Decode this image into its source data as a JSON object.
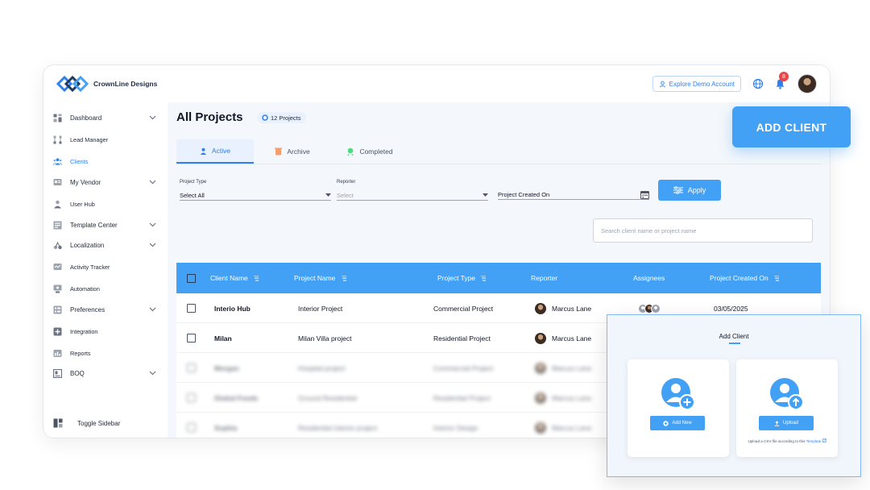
{
  "brand": {
    "name": "CrownLine Designs"
  },
  "topbar": {
    "demo_label": "Explore Demo Account",
    "notification_count": "8"
  },
  "sidebar": {
    "items": [
      {
        "label": "Dashboard",
        "icon": "grid-icon",
        "chevron": true
      },
      {
        "label": "Lead Manager",
        "icon": "flow-icon",
        "chevron": false
      },
      {
        "label": "Clients",
        "icon": "users-icon",
        "chevron": false,
        "active": true
      },
      {
        "label": "My Vendor",
        "icon": "vendor-icon",
        "chevron": true
      },
      {
        "label": "User Hub",
        "icon": "user-icon",
        "chevron": false
      },
      {
        "label": "Template Center",
        "icon": "template-icon",
        "chevron": true
      },
      {
        "label": "Localization",
        "icon": "localization-icon",
        "chevron": true
      },
      {
        "label": "Activity Tracker",
        "icon": "activity-icon",
        "chevron": false
      },
      {
        "label": "Automation",
        "icon": "automation-icon",
        "chevron": false
      },
      {
        "label": "Preferences",
        "icon": "preferences-icon",
        "chevron": true
      },
      {
        "label": "Integration",
        "icon": "integration-icon",
        "chevron": false
      },
      {
        "label": "Reports",
        "icon": "reports-icon",
        "chevron": false
      },
      {
        "label": "BOQ",
        "icon": "boq-icon",
        "chevron": true
      }
    ],
    "toggle_label": "Toggle Sidebar"
  },
  "main": {
    "title": "All Projects",
    "project_count": "12 Projects",
    "tabs": [
      {
        "label": "Active",
        "active": true
      },
      {
        "label": "Archive",
        "active": false
      },
      {
        "label": "Completed",
        "active": false
      }
    ],
    "filters": {
      "project_type_label": "Project Type",
      "project_type_value": "Select All",
      "reporter_label": "Reporter",
      "reporter_placeholder": "Select",
      "date_label": "Project Created On",
      "apply_label": "Apply"
    },
    "search_placeholder": "Search client name or project name"
  },
  "table": {
    "headers": [
      "Client Name",
      "Project Name",
      "Project Type",
      "Reporter",
      "Assignees",
      "Project Created On"
    ],
    "rows": [
      {
        "client": "Interio Hub",
        "project": "Interior Project",
        "type": "Commercial Project",
        "reporter": "Marcus Lane",
        "date": "03/05/2025"
      },
      {
        "client": "Milan",
        "project": "Milan Villa project",
        "type": "Residential Project",
        "reporter": "Marcus Lane",
        "date": ""
      }
    ],
    "blurred_rows": [
      {
        "client": "Morgan",
        "project": "Hospital project",
        "type": "Commercial Project",
        "reporter": "Marcus Lane"
      },
      {
        "client": "Global Foods",
        "project": "Ground Residential",
        "type": "Residential Project",
        "reporter": "Marcus Lane"
      },
      {
        "client": "Sophia",
        "project": "Residential interior project",
        "type": "Interior Design",
        "reporter": "Marcus Lane"
      }
    ]
  },
  "add_client_button": "ADD CLIENT",
  "panel": {
    "title": "Add Client",
    "add_new_label": "Add New",
    "upload_label": "Upload",
    "upload_note": "Upload a CSV file according to this",
    "upload_note_link": "Template"
  },
  "colors": {
    "accent": "#42a0f5",
    "link": "#2f80ed",
    "badge": "#ef4444"
  }
}
